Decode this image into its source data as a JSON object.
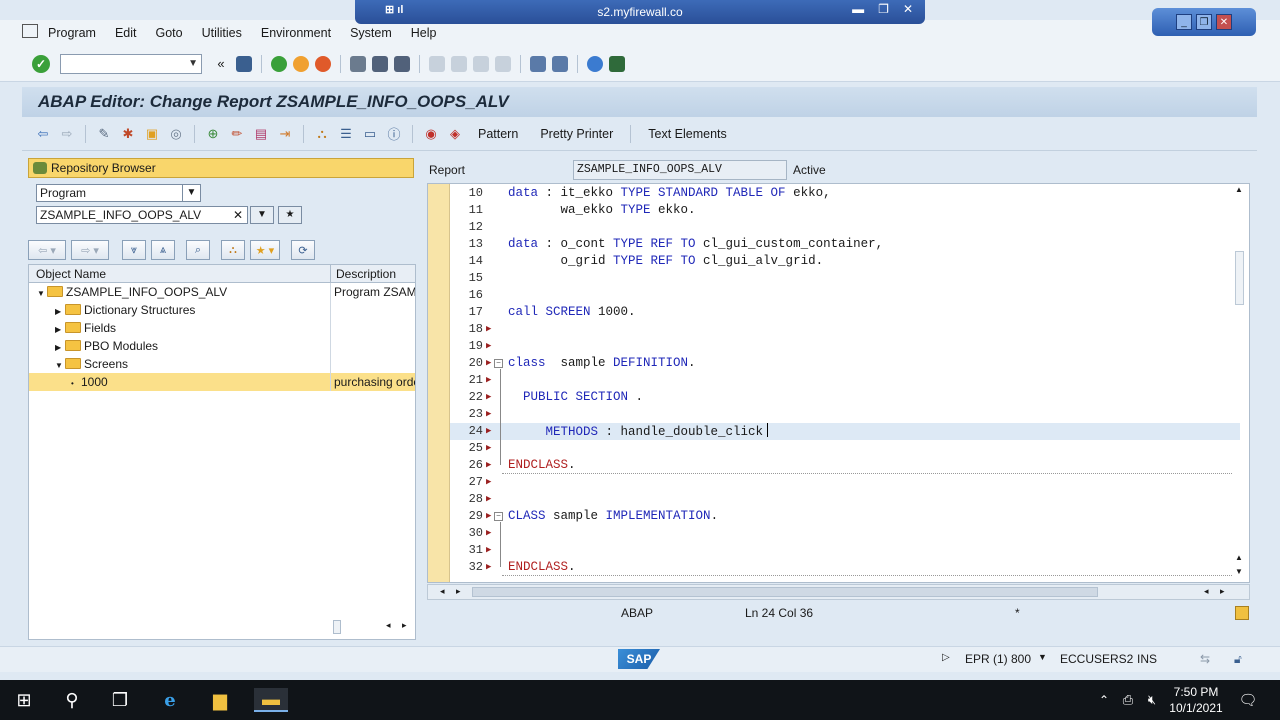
{
  "remote": {
    "host": "s2.myfirewall.co"
  },
  "menu": [
    "Program",
    "Edit",
    "Goto",
    "Utilities",
    "Environment",
    "System",
    "Help"
  ],
  "title": "ABAP Editor: Change Report ZSAMPLE_INFO_OOPS_ALV",
  "apptoolbar": {
    "pattern": "Pattern",
    "pretty_printer": "Pretty Printer",
    "text_elements": "Text Elements"
  },
  "repo": {
    "header": "Repository Browser",
    "object_type": "Program",
    "object_name": "ZSAMPLE_INFO_OOPS_ALV",
    "col_name": "Object Name",
    "col_desc": "Description",
    "rows": [
      {
        "label": "ZSAMPLE_INFO_OOPS_ALV",
        "desc": "Program ZSAMF",
        "arrow": "▼",
        "indent": 8,
        "folder": true
      },
      {
        "label": "Dictionary Structures",
        "desc": "",
        "arrow": "▶",
        "indent": 26,
        "folder": true
      },
      {
        "label": "Fields",
        "desc": "",
        "arrow": "▶",
        "indent": 26,
        "folder": true
      },
      {
        "label": "PBO Modules",
        "desc": "",
        "arrow": "▶",
        "indent": 26,
        "folder": true
      },
      {
        "label": "Screens",
        "desc": "",
        "arrow": "▼",
        "indent": 26,
        "folder": true
      },
      {
        "label": "1000",
        "desc": "purchasing orde",
        "arrow": "•",
        "indent": 42,
        "folder": false
      }
    ]
  },
  "editor_head": {
    "label": "Report",
    "program": "ZSAMPLE_INFO_OOPS_ALV",
    "status": "Active"
  },
  "code_lines": [
    {
      "n": "10",
      "html": "<span class='kw'>data</span> : it_ekko <span class='kw'>TYPE STANDARD TABLE OF</span> ekko,"
    },
    {
      "n": "11",
      "html": "       wa_ekko <span class='kw'>TYPE</span> ekko."
    },
    {
      "n": "12",
      "html": ""
    },
    {
      "n": "13",
      "html": "<span class='kw'>data</span> : o_cont <span class='kw'>TYPE REF TO</span> cl_gui_custom_container,"
    },
    {
      "n": "14",
      "html": "       o_grid <span class='kw'>TYPE REF TO</span> cl_gui_alv_grid."
    },
    {
      "n": "15",
      "html": ""
    },
    {
      "n": "16",
      "html": ""
    },
    {
      "n": "17",
      "html": "<span class='kw'>call SCREEN</span> 1000."
    },
    {
      "n": "18",
      "html": "",
      "mk": true
    },
    {
      "n": "19",
      "html": "",
      "mk": true
    },
    {
      "n": "20",
      "html": "<span class='kw'>class</span>  sample <span class='kw'>DEFINITION</span>.",
      "mk": true,
      "fold": true
    },
    {
      "n": "21",
      "html": "",
      "mk": true
    },
    {
      "n": "22",
      "html": "  <span class='kw'>PUBLIC SECTION</span> .",
      "mk": true
    },
    {
      "n": "23",
      "html": "",
      "mk": true
    },
    {
      "n": "24",
      "html": "     <span class='kw'>METHODS</span> : handle_double_click",
      "mk": true,
      "cur": true
    },
    {
      "n": "25",
      "html": "",
      "mk": true
    },
    {
      "n": "26",
      "html": "<span class='ed'>ENDCLASS</span>.",
      "mk": true
    },
    {
      "n": "27",
      "html": "",
      "mk": true
    },
    {
      "n": "28",
      "html": "",
      "mk": true
    },
    {
      "n": "29",
      "html": "<span class='kw'>CLASS</span> sample <span class='kw'>IMPLEMENTATION</span>.",
      "mk": true,
      "fold": true
    },
    {
      "n": "30",
      "html": "",
      "mk": true
    },
    {
      "n": "31",
      "html": "",
      "mk": true
    },
    {
      "n": "32",
      "html": "<span class='ed'>ENDCLASS</span>.",
      "mk": true
    }
  ],
  "editor_status": {
    "lang": "ABAP",
    "pos": "Ln  24 Col  36",
    "mod": "*"
  },
  "sapbar": {
    "system": "EPR (1) 800",
    "server": "ECCUSERS2",
    "mode": "INS"
  },
  "clock": {
    "time": "7:50 PM",
    "date": "10/1/2021"
  },
  "colors": {
    "repo_header": "#f9d66b",
    "keyword": "#2028b8",
    "endclass": "#b02020",
    "gutter": "#f8e4a8"
  }
}
